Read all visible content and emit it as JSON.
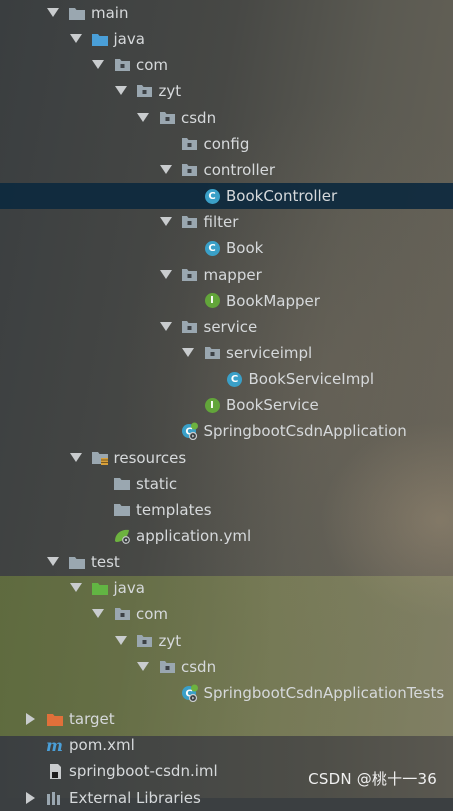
{
  "project_tree": {
    "rows": [
      {
        "name": "main",
        "icon": "folder-icon",
        "arrow": "expanded",
        "depth": 0,
        "type": "folder"
      },
      {
        "name": "java",
        "icon": "source-folder-icon",
        "arrow": "expanded",
        "depth": 1,
        "type": "src"
      },
      {
        "name": "com",
        "icon": "package-icon",
        "arrow": "expanded",
        "depth": 2,
        "type": "pkg"
      },
      {
        "name": "zyt",
        "icon": "package-icon",
        "arrow": "expanded",
        "depth": 3,
        "type": "pkg"
      },
      {
        "name": "csdn",
        "icon": "package-icon",
        "arrow": "expanded",
        "depth": 4,
        "type": "pkg"
      },
      {
        "name": "config",
        "icon": "package-icon",
        "arrow": "none",
        "depth": 5,
        "type": "pkg"
      },
      {
        "name": "controller",
        "icon": "package-icon",
        "arrow": "expanded",
        "depth": 5,
        "type": "pkg"
      },
      {
        "name": "BookController",
        "icon": "class-icon",
        "arrow": "none",
        "depth": 6,
        "type": "class",
        "selected": true
      },
      {
        "name": "filter",
        "icon": "package-icon",
        "arrow": "expanded",
        "depth": 5,
        "type": "pkg"
      },
      {
        "name": "Book",
        "icon": "class-icon",
        "arrow": "none",
        "depth": 6,
        "type": "class"
      },
      {
        "name": "mapper",
        "icon": "package-icon",
        "arrow": "expanded",
        "depth": 5,
        "type": "pkg"
      },
      {
        "name": "BookMapper",
        "icon": "interface-icon",
        "arrow": "none",
        "depth": 6,
        "type": "iface"
      },
      {
        "name": "service",
        "icon": "package-icon",
        "arrow": "expanded",
        "depth": 5,
        "type": "pkg"
      },
      {
        "name": "serviceimpl",
        "icon": "package-icon",
        "arrow": "expanded",
        "depth": 6,
        "type": "pkg"
      },
      {
        "name": "BookServiceImpl",
        "icon": "class-icon",
        "arrow": "none",
        "depth": 7,
        "type": "class"
      },
      {
        "name": "BookService",
        "icon": "interface-icon",
        "arrow": "none",
        "depth": 6,
        "type": "iface"
      },
      {
        "name": "SpringbootCsdnApplication",
        "icon": "spring-boot-class-icon",
        "arrow": "none",
        "depth": 5,
        "type": "boot"
      },
      {
        "name": "resources",
        "icon": "resources-folder-icon",
        "arrow": "expanded",
        "depth": 1,
        "type": "res"
      },
      {
        "name": "static",
        "icon": "folder-icon",
        "arrow": "none",
        "depth": 2,
        "type": "folder"
      },
      {
        "name": "templates",
        "icon": "folder-icon",
        "arrow": "none",
        "depth": 2,
        "type": "folder"
      },
      {
        "name": "application.yml",
        "icon": "spring-yml-icon",
        "arrow": "none",
        "depth": 2,
        "type": "yml"
      },
      {
        "name": "test",
        "icon": "folder-icon",
        "arrow": "expanded",
        "depth": 0,
        "type": "folder"
      },
      {
        "name": "java",
        "icon": "test-source-folder-icon",
        "arrow": "expanded",
        "depth": 1,
        "type": "testsrc"
      },
      {
        "name": "com",
        "icon": "package-icon",
        "arrow": "expanded",
        "depth": 2,
        "type": "pkg"
      },
      {
        "name": "zyt",
        "icon": "package-icon",
        "arrow": "expanded",
        "depth": 3,
        "type": "pkg"
      },
      {
        "name": "csdn",
        "icon": "package-icon",
        "arrow": "expanded",
        "depth": 4,
        "type": "pkg"
      },
      {
        "name": "SpringbootCsdnApplicationTests",
        "icon": "spring-boot-test-icon",
        "arrow": "none",
        "depth": 5,
        "type": "boot"
      },
      {
        "name": "target",
        "icon": "excluded-folder-icon",
        "arrow": "collapsed",
        "depth": -1,
        "type": "target"
      },
      {
        "name": "pom.xml",
        "icon": "maven-icon",
        "arrow": "none",
        "depth": -1,
        "type": "maven"
      },
      {
        "name": "springboot-csdn.iml",
        "icon": "iml-file-icon",
        "arrow": "none",
        "depth": -1,
        "type": "iml"
      },
      {
        "name": "External Libraries",
        "icon": "libraries-icon",
        "arrow": "collapsed",
        "depth": -1,
        "type": "libs"
      }
    ]
  },
  "watermark": "CSDN @桃十一36",
  "colors": {
    "selection": "#0d293e",
    "text": "#d6d9db",
    "class_icon": "#3aa0c8",
    "interface_icon": "#62a53a",
    "folder_gray": "#9aa7b0",
    "source_folder_blue": "#4a9fd8",
    "test_folder_green": "#62b543",
    "target_folder_orange": "#e0703a"
  }
}
